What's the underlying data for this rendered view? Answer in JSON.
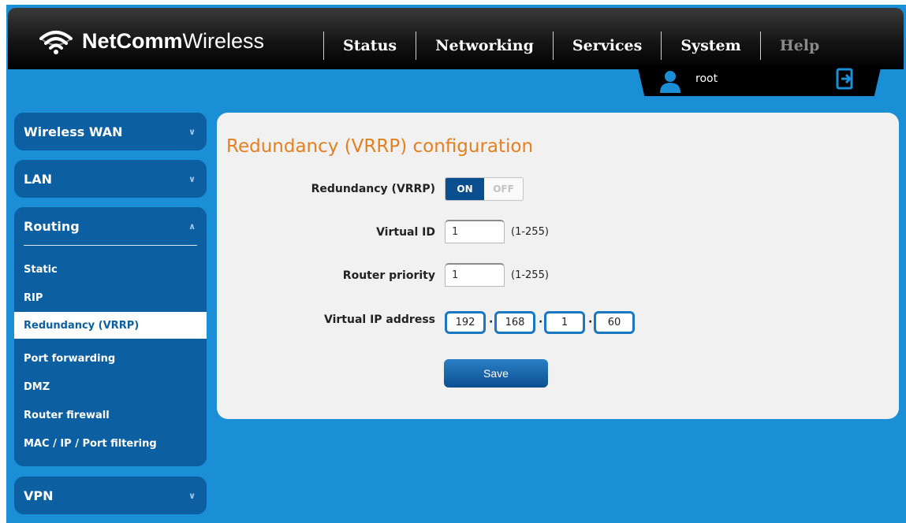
{
  "header": {
    "brand_bold": "NetComm",
    "brand_light": "Wireless",
    "nav": [
      "Status",
      "Networking",
      "Services",
      "System",
      "Help"
    ],
    "user": "root"
  },
  "sidebar": {
    "wireless_wan": "Wireless WAN",
    "lan": "LAN",
    "routing": "Routing",
    "routing_items": [
      "Static",
      "RIP",
      "Redundancy (VRRP)",
      "Port forwarding",
      "DMZ",
      "Router firewall",
      "MAC / IP / Port filtering"
    ],
    "active_item": "Redundancy (VRRP)",
    "vpn": "VPN"
  },
  "main": {
    "title": "Redundancy (VRRP) configuration",
    "vrrp_label": "Redundancy (VRRP)",
    "toggle_on": "ON",
    "toggle_off": "OFF",
    "toggle_state": "ON",
    "virtual_id_label": "Virtual ID",
    "virtual_id_value": "1",
    "virtual_id_hint": "(1-255)",
    "router_priority_label": "Router priority",
    "router_priority_value": "1",
    "router_priority_hint": "(1-255)",
    "virtual_ip_label": "Virtual IP address",
    "virtual_ip": [
      "192",
      "168",
      "1",
      "60"
    ],
    "save": "Save"
  },
  "colors": {
    "background_blue": "#1a8fd6",
    "sidebar_blue": "#0c5fa0",
    "title_orange": "#e58020",
    "ip_border": "#1a78c2"
  }
}
